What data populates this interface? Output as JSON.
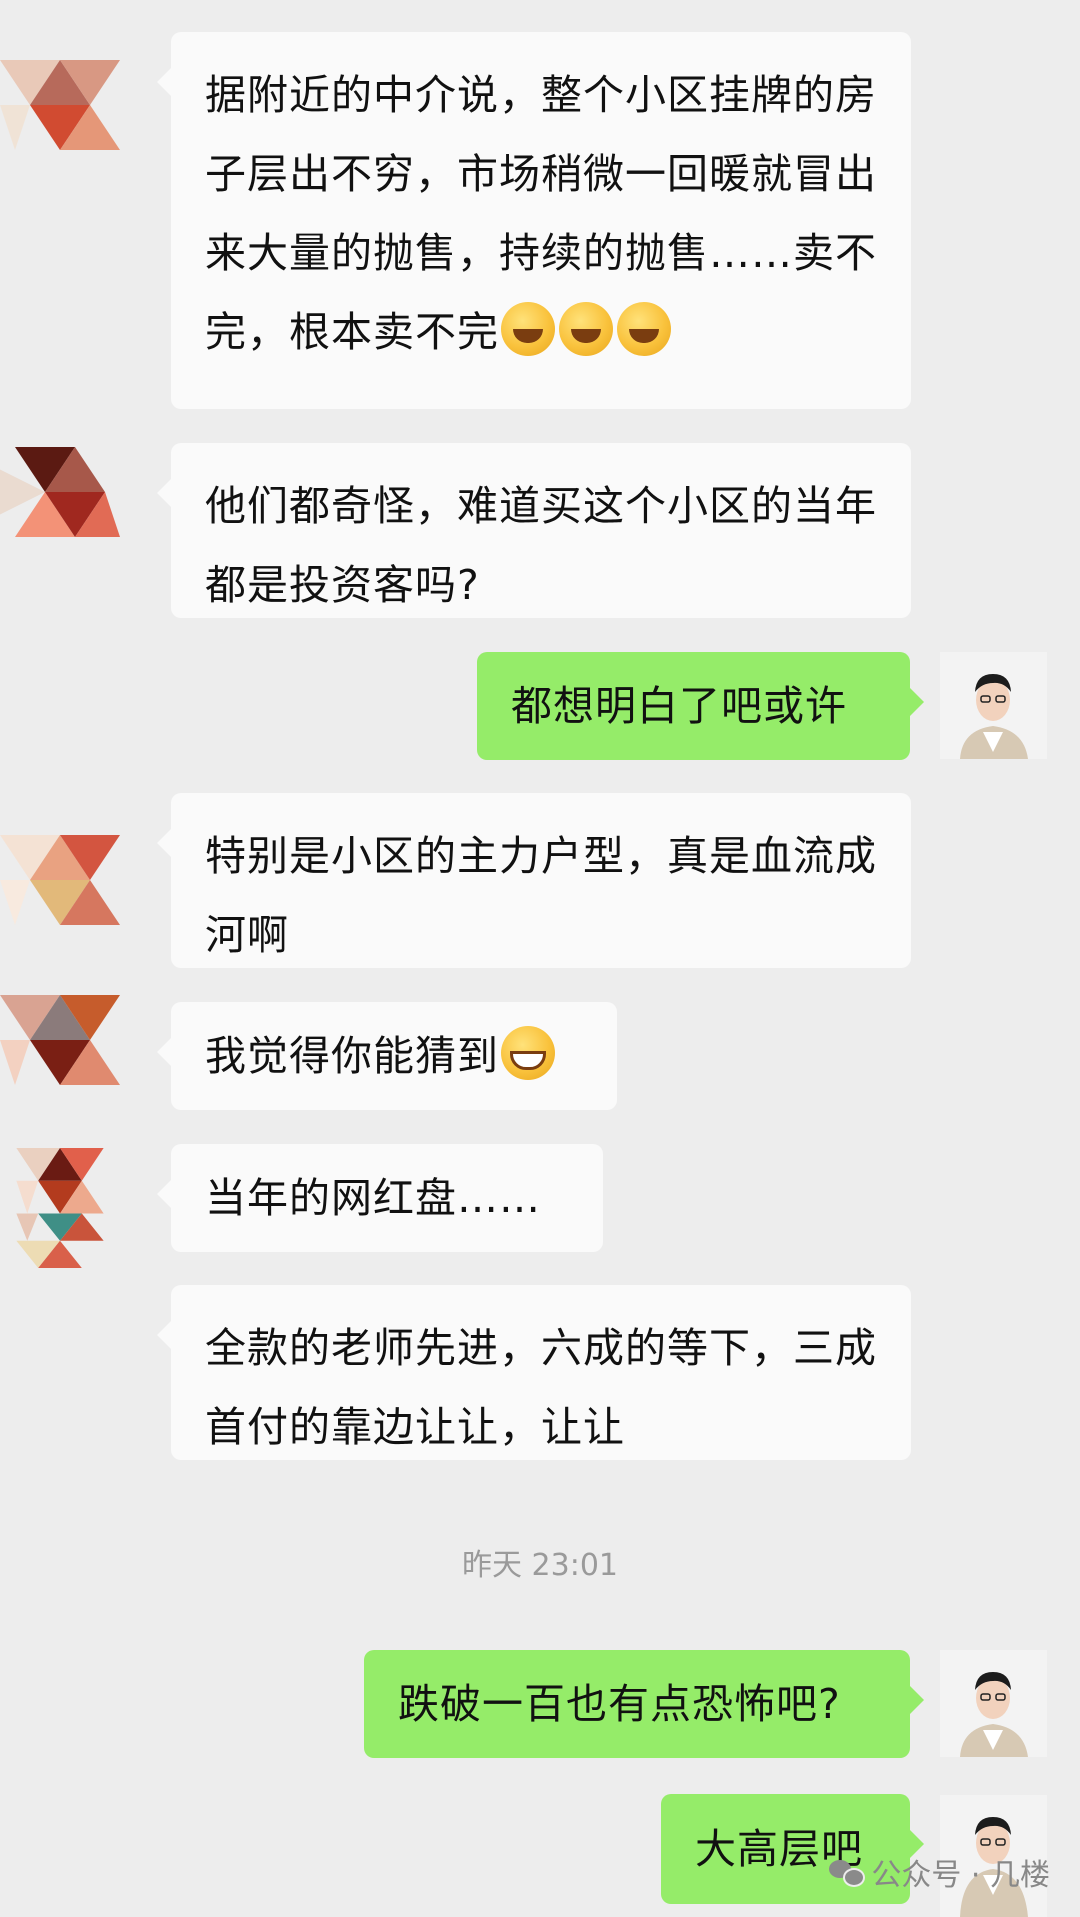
{
  "messages": [
    {
      "side": "in",
      "text_parts": [
        "据附近的中介说，整个小区挂牌的房子层出不穷，市场稍微一回暖就冒出来大量的抛售，持续的抛售……卖不完，根本卖不完"
      ],
      "emoji": [
        "face-with-tears-of-joy-emoji",
        "face-with-tears-of-joy-emoji",
        "face-with-tears-of-joy-emoji"
      ]
    },
    {
      "side": "in",
      "text": "他们都奇怪，难道买这个小区的当年都是投资客吗?"
    },
    {
      "side": "out",
      "text": "都想明白了吧或许"
    },
    {
      "side": "in",
      "text": "特别是小区的主力户型，真是血流成河啊"
    },
    {
      "side": "in",
      "text": "我觉得你能猜到",
      "emoji": [
        "grinning-face-emoji"
      ]
    },
    {
      "side": "in",
      "text": "当年的网红盘……"
    },
    {
      "side": "in",
      "text": "全款的老师先进，六成的等下，三成首付的靠边让让，让让"
    },
    {
      "side": "out",
      "text": "跌破一百也有点恐怖吧?"
    },
    {
      "side": "out",
      "text": "大高层吧"
    }
  ],
  "timestamp": "昨天 23:01",
  "watermark": {
    "text": "公众号 · 几楼",
    "icon": "wechat-icon"
  },
  "colors": {
    "background": "#ededed",
    "incoming": "#fafafa",
    "outgoing": "#95ec69"
  }
}
